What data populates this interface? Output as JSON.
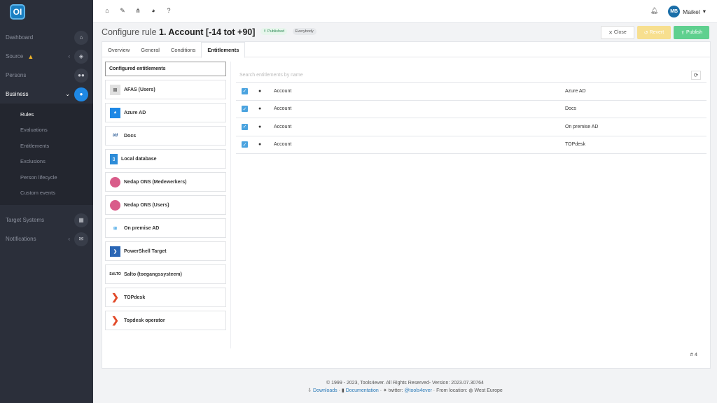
{
  "app": {
    "logo": "OI"
  },
  "sidebar": {
    "items": [
      {
        "label": "Dashboard",
        "icon": "home-icon"
      },
      {
        "label": "Source",
        "icon": "cube-icon"
      },
      {
        "label": "Persons",
        "icon": "users-icon"
      },
      {
        "label": "Business",
        "icon": "briefcase-icon"
      }
    ],
    "subitems": [
      "Rules",
      "Evaluations",
      "Entitlements",
      "Exclusions",
      "Person lifecycle",
      "Custom events"
    ],
    "bottom": [
      {
        "label": "Target Systems",
        "icon": "grid-icon"
      },
      {
        "label": "Notifications",
        "icon": "envelope-icon"
      }
    ]
  },
  "topbar": {
    "user_initials": "MB",
    "user_name": "Maikel"
  },
  "header": {
    "title_prefix": "Configure rule ",
    "title_bold": "1. Account [-14 tot +90]",
    "badge_published": "Published",
    "badge_everybody": "Everybody",
    "close_label": "Close",
    "revert_label": "Revert",
    "publish_label": "Publish"
  },
  "tabs": [
    "Overview",
    "General",
    "Conditions",
    "Entitlements"
  ],
  "left": {
    "heading": "Configured entitlements",
    "systems": [
      {
        "label": "AFAS (Users)",
        "icon": "afas-logo-icon",
        "color": "#e0e0e0"
      },
      {
        "label": "Azure AD",
        "icon": "azure-logo-icon",
        "color": "#1e88e5"
      },
      {
        "label": "Docs",
        "icon": "idoc-logo-icon",
        "color": "#ffffff"
      },
      {
        "label": "Local database",
        "icon": "file-icon",
        "color": "#2d8cd8"
      },
      {
        "label": "Nedap ONS (Medewerkers)",
        "icon": "nedap-logo-icon",
        "color": "#d95c8a"
      },
      {
        "label": "Nedap ONS (Users)",
        "icon": "nedap-logo-icon",
        "color": "#d95c8a"
      },
      {
        "label": "On premise AD",
        "icon": "windows-logo-icon",
        "color": "#3aa0e4"
      },
      {
        "label": "PowerShell Target",
        "icon": "powershell-logo-icon",
        "color": "#2a66b5"
      },
      {
        "label": "Salto (toegangssysteem)",
        "icon": "salto-logo-icon",
        "color": "#ffffff"
      },
      {
        "label": "TOPdesk",
        "icon": "topdesk-logo-icon",
        "color": "#e24b2a"
      },
      {
        "label": "Topdesk operator",
        "icon": "topdesk-logo-icon",
        "color": "#e24b2a"
      }
    ]
  },
  "right": {
    "search_placeholder": "Search entitlements by name",
    "rows": [
      {
        "name": "Account",
        "system": "Azure AD"
      },
      {
        "name": "Account",
        "system": "Docs"
      },
      {
        "name": "Account",
        "system": "On premise AD"
      },
      {
        "name": "Account",
        "system": "TOPdesk"
      }
    ],
    "count_label": "# 4"
  },
  "footer": {
    "copyright": "© 1999 - 2023, Tools4ever. All Rights Reserved- Version: 2023.07.30764",
    "downloads": "Downloads",
    "documentation": "Documentation",
    "twitter_prefix": "twitter:",
    "twitter_handle": "@tools4ever",
    "location": "From location:",
    "region": "West Europe"
  }
}
